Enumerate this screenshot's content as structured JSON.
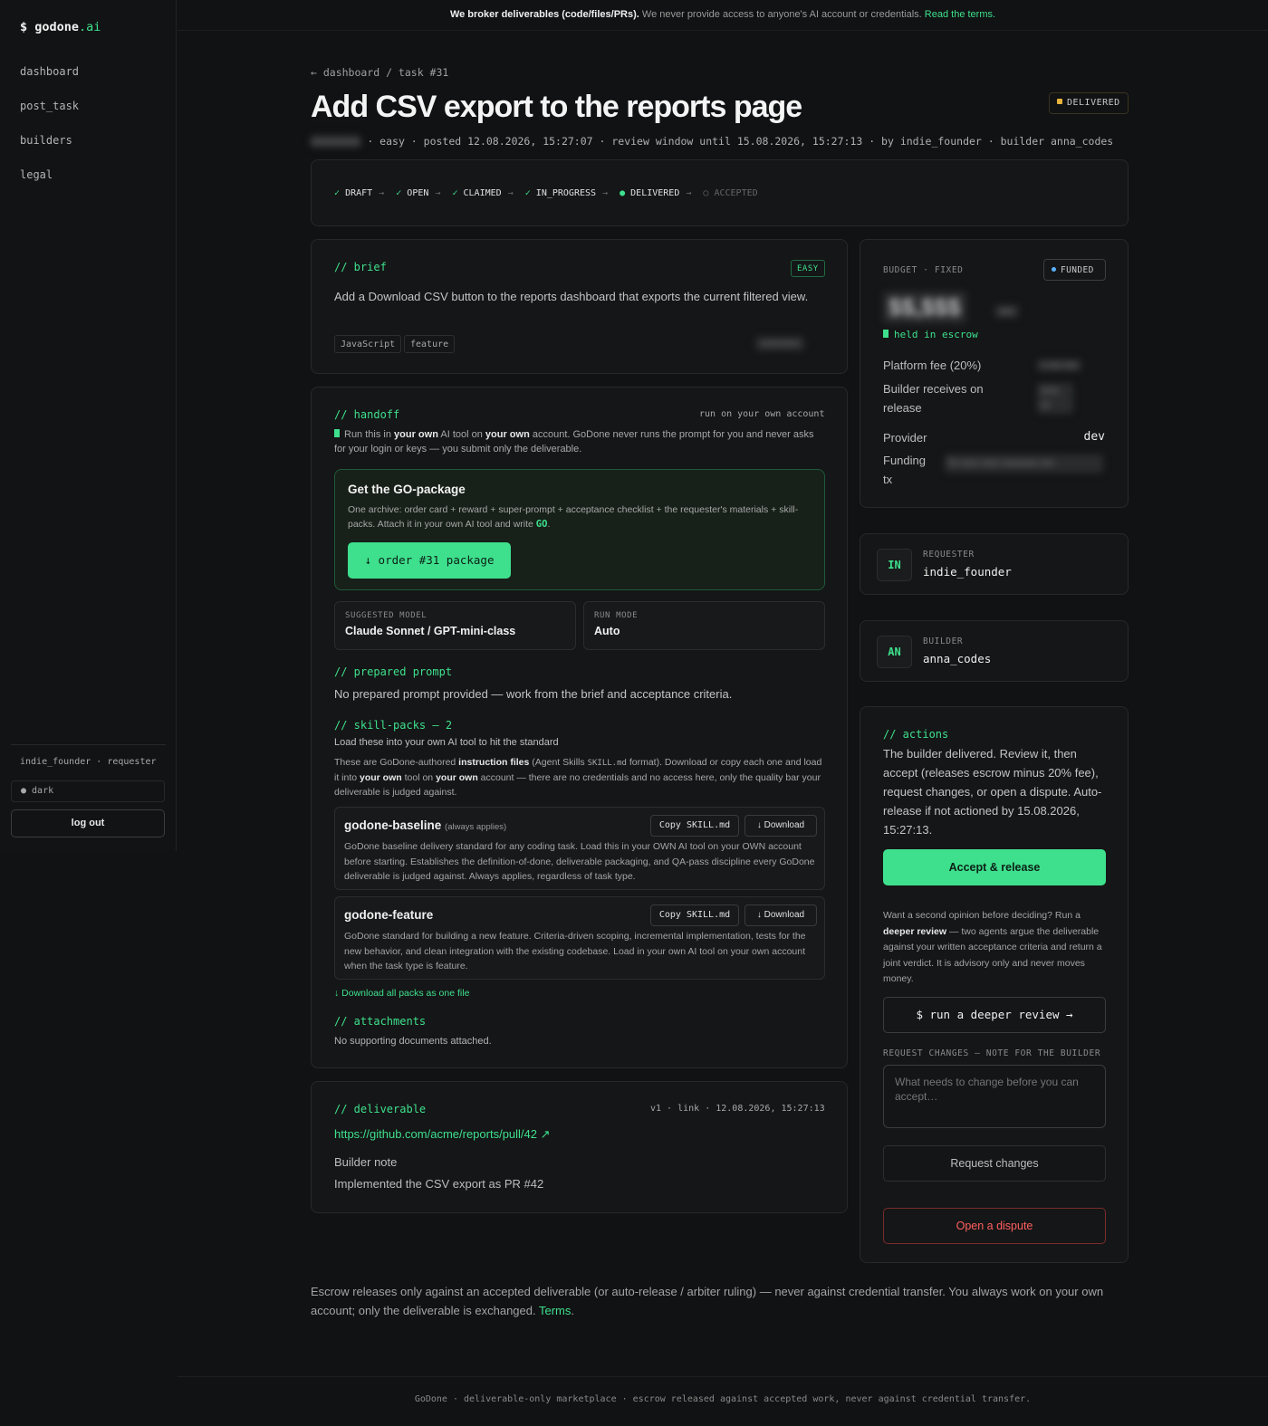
{
  "brand": {
    "prefix": "$ godone",
    "suffix": ".ai"
  },
  "nav": [
    "dashboard",
    "post_task",
    "builders",
    "legal"
  ],
  "sidebar_footer": {
    "user": "indie_founder · requester",
    "theme": "● dark",
    "logout": "log out"
  },
  "banner": {
    "bold": "We broker deliverables (code/files/PRs).",
    "text": " We never provide access to anyone's AI account or credentials. ",
    "link": "Read the terms."
  },
  "breadcrumb": "← dashboard / task #31",
  "title": "Add CSV export to the reports page",
  "status": "DELIVERED",
  "meta": {
    "blurred": "xxxxxxxx",
    "text": "· easy · posted 12.08.2026, 15:27:07 · review window until 15.08.2026, 15:27:13 · by indie_founder · builder anna_codes"
  },
  "pipeline": [
    {
      "label": "DRAFT",
      "state": "done"
    },
    {
      "label": "OPEN",
      "state": "done"
    },
    {
      "label": "CLAIMED",
      "state": "done"
    },
    {
      "label": "IN_PROGRESS",
      "state": "done"
    },
    {
      "label": "DELIVERED",
      "state": "current"
    },
    {
      "label": "ACCEPTED",
      "state": "pending"
    }
  ],
  "brief": {
    "heading": "// brief",
    "difficulty": "EASY",
    "text": "Add a Download CSV button to the reports dashboard that exports the current filtered view.",
    "tags": [
      "JavaScript",
      "feature"
    ],
    "blurred": "xxxxxxx"
  },
  "handoff": {
    "heading": "// handoff",
    "hint": "run on your own account",
    "notice": {
      "p1": "Run this in ",
      "b1": "your own",
      "p2": " AI tool on ",
      "b2": "your own",
      "p3": " account. GoDone never runs the prompt for you and never asks for your login or keys — you submit only the deliverable."
    },
    "package": {
      "title": "Get the GO-package",
      "desc": "One archive: order card + reward + super-prompt + acceptance checklist + the requester's materials + skill-packs. Attach it in your own AI tool and write ",
      "go": "GO",
      "end": ".",
      "button": "↓ order #31 package"
    },
    "suggested_model": {
      "label": "SUGGESTED MODEL",
      "value": "Claude Sonnet / GPT-mini-class"
    },
    "run_mode": {
      "label": "RUN MODE",
      "value": "Auto"
    },
    "prepared_heading": "// prepared prompt",
    "prepared_text": "No prepared prompt provided — work from the brief and acceptance criteria.",
    "skills_heading": "// skill-packs — 2",
    "skills_sub": "Load these into your own AI tool to hit the standard",
    "skills_note": {
      "p1": "These are GoDone-authored ",
      "b1": "instruction files",
      "p2": " (Agent Skills ",
      "code": "SKILL.md",
      "p3": " format). Download or copy each one and load it into ",
      "b2": "your own",
      "p4": " tool on ",
      "b3": "your own",
      "p5": " account — there are no credentials and no access here, only the quality bar your deliverable is judged against."
    },
    "skills": [
      {
        "name": "godone-baseline",
        "tag": "(always applies)",
        "desc": "GoDone baseline delivery standard for any coding task. Load this in your OWN AI tool on your OWN account before starting. Establishes the definition-of-done, deliverable packaging, and QA-pass discipline every GoDone deliverable is judged against. Always applies, regardless of task type.",
        "copy": "Copy SKILL.md",
        "download": "↓ Download"
      },
      {
        "name": "godone-feature",
        "tag": "",
        "desc": "GoDone standard for building a new feature. Criteria-driven scoping, incremental implementation, tests for the new behavior, and clean integration with the existing codebase. Load in your own AI tool on your own account when the task type is feature.",
        "copy": "Copy SKILL.md",
        "download": "↓ Download"
      }
    ],
    "download_all": "↓ Download all packs as one file",
    "attachments_heading": "// attachments",
    "attachments_text": "No supporting documents attached."
  },
  "deliverable": {
    "heading": "// deliverable",
    "meta": "v1 · link · 12.08.2026, 15:27:13",
    "link": "https://github.com/acme/reports/pull/42 ↗",
    "note_label": "Builder note",
    "note": "Implemented the CSV export as PR #42"
  },
  "budget": {
    "label": "BUDGET · FIXED",
    "funded": "FUNDED",
    "amount_blurred": "$$,$$$",
    "unit_blurred": "xxx",
    "escrow": "held in escrow",
    "fee_label": "Platform fee (20%)",
    "fee_blurred": "x xxx xxx",
    "receives_label": "Builder receives on release",
    "receives_blurred": "xxxx xx",
    "provider_label": "Provider",
    "provider_value": "dev",
    "tx_label": "Funding tx",
    "tx_blurred": "0x xxxx xxxx xxxxxxxx xxx"
  },
  "requester": {
    "initials": "IN",
    "label": "REQUESTER",
    "name": "indie_founder"
  },
  "builder": {
    "initials": "AN",
    "label": "BUILDER",
    "name": "anna_codes"
  },
  "actions": {
    "heading": "// actions",
    "text": "The builder delivered. Review it, then accept (releases escrow minus 20% fee), request changes, or open a dispute. Auto-release if not actioned by 15.08.2026, 15:27:13.",
    "accept": "Accept & release",
    "opinion": {
      "p1": "Want a second opinion before deciding? Run a ",
      "b": "deeper review",
      "p2": " — two agents argue the deliverable against your written acceptance criteria and return a joint verdict. It is advisory only and never moves money."
    },
    "deeper": "$ run a deeper review →",
    "request_label": "REQUEST CHANGES — NOTE FOR THE BUILDER",
    "placeholder": "What needs to change before you can accept…",
    "request_button": "Request changes",
    "dispute": "Open a dispute"
  },
  "footnote": {
    "text": "Escrow releases only against an accepted deliverable (or auto-release / arbiter ruling) — never against credential transfer. You always work on your own account; only the deliverable is exchanged. ",
    "link": "Terms",
    "end": "."
  },
  "footer": "GoDone · deliverable-only marketplace · escrow released against accepted work, never against credential transfer."
}
